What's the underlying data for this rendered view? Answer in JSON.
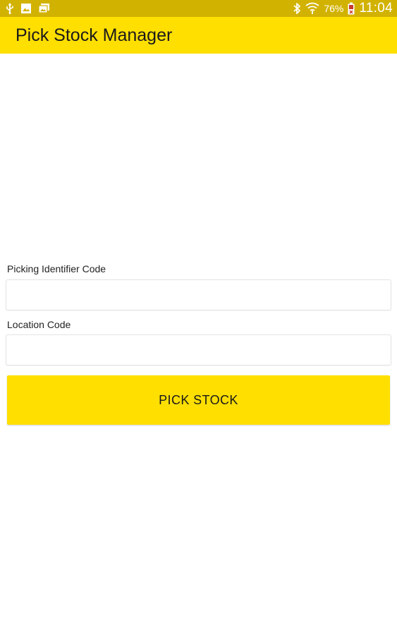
{
  "status_bar": {
    "left_icons": [
      "usb-icon",
      "image-icon",
      "photo-stack-icon"
    ],
    "right_icons": [
      "bluetooth-icon",
      "wifi-icon",
      "battery-icon"
    ],
    "battery_percent": "76%",
    "time": "11:04",
    "background_color": "#d2b200"
  },
  "app_bar": {
    "title": "Pick Stock Manager",
    "background_color": "#ffdf00"
  },
  "form": {
    "picking_label": "Picking Identifier Code",
    "picking_value": "",
    "location_label": "Location Code",
    "location_value": "",
    "submit_label": "PICK STOCK",
    "button_color": "#ffdf00"
  }
}
